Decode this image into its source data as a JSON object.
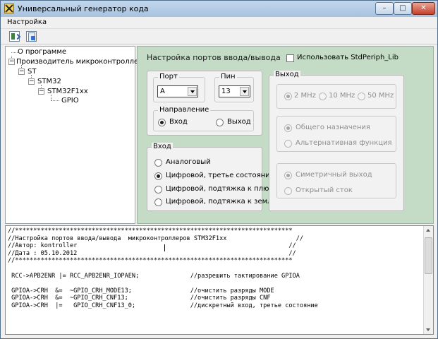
{
  "window": {
    "title": "Универсальный генератор кода",
    "minimize_glyph": "–",
    "maximize_glyph": "□",
    "close_glyph": "✕"
  },
  "menu": {
    "items": [
      {
        "label": "Настройка"
      }
    ]
  },
  "toolbar": {
    "buttons": [
      {
        "icon": "export-icon"
      },
      {
        "icon": "settings-doc-icon"
      }
    ]
  },
  "tree": {
    "items": [
      {
        "label": "О программе"
      },
      {
        "label": "Производитель микроконтроллеров",
        "expander": "−"
      },
      {
        "label": "ST",
        "expander": "−"
      },
      {
        "label": "STM32",
        "expander": "−"
      },
      {
        "label": "STM32F1xx",
        "expander": "−"
      },
      {
        "label": "GPIO"
      }
    ]
  },
  "panel": {
    "title": "Настройка портов ввода/вывода",
    "stdperiph_label": "Использовать StdPeriph_Lib",
    "stdperiph_checked": false,
    "background": "#c4dcc6"
  },
  "port": {
    "legend": "Порт",
    "value": "A"
  },
  "pin": {
    "legend": "Пин",
    "value": "13"
  },
  "direction": {
    "legend": "Направление",
    "options": [
      "Вход",
      "Выход"
    ],
    "selected": 0
  },
  "input": {
    "legend": "Вход",
    "options": [
      "Аналоговый",
      "Цифровой, третье состояние",
      "Цифровой, подтяжка к плюсу",
      "Цифровой, подтяжка к земле"
    ],
    "selected": 1
  },
  "output": {
    "legend": "Выход",
    "speed": {
      "options": [
        "2 MHz",
        "10 MHz",
        "50 MHz"
      ],
      "selected": 0
    },
    "mode": {
      "options": [
        "Общего назначения",
        "Альтернативная функция"
      ],
      "selected": 0
    },
    "type": {
      "options": [
        "Симетричный выход",
        "Открытый сток"
      ],
      "selected": 0
    }
  },
  "code": {
    "lines": [
      "//****************************************************************************",
      "//Настройка портов ввода/вывода  микроконтроллеров STM32F1xx                   //",
      "//Автор: kontroller                                                          //",
      "//Дата : 05.10.2012                                                          //",
      "//****************************************************************************",
      "",
      " RCC->APB2ENR |= RCC_APB2ENR_IOPAEN;              //разрешить тактирование GPIOA",
      "",
      " GPIOA->CRH  &=  ~GPIO_CRH_MODE13;                //очистить разряды MODE",
      " GPIOA->CRH  &=  ~GPIO_CRH_CNF13;                 //очистить разряды CNF",
      " GPIOA->CRH  |=   GPIO_CRH_CNF13_0;               //дискретный вход, третье состояние"
    ]
  }
}
